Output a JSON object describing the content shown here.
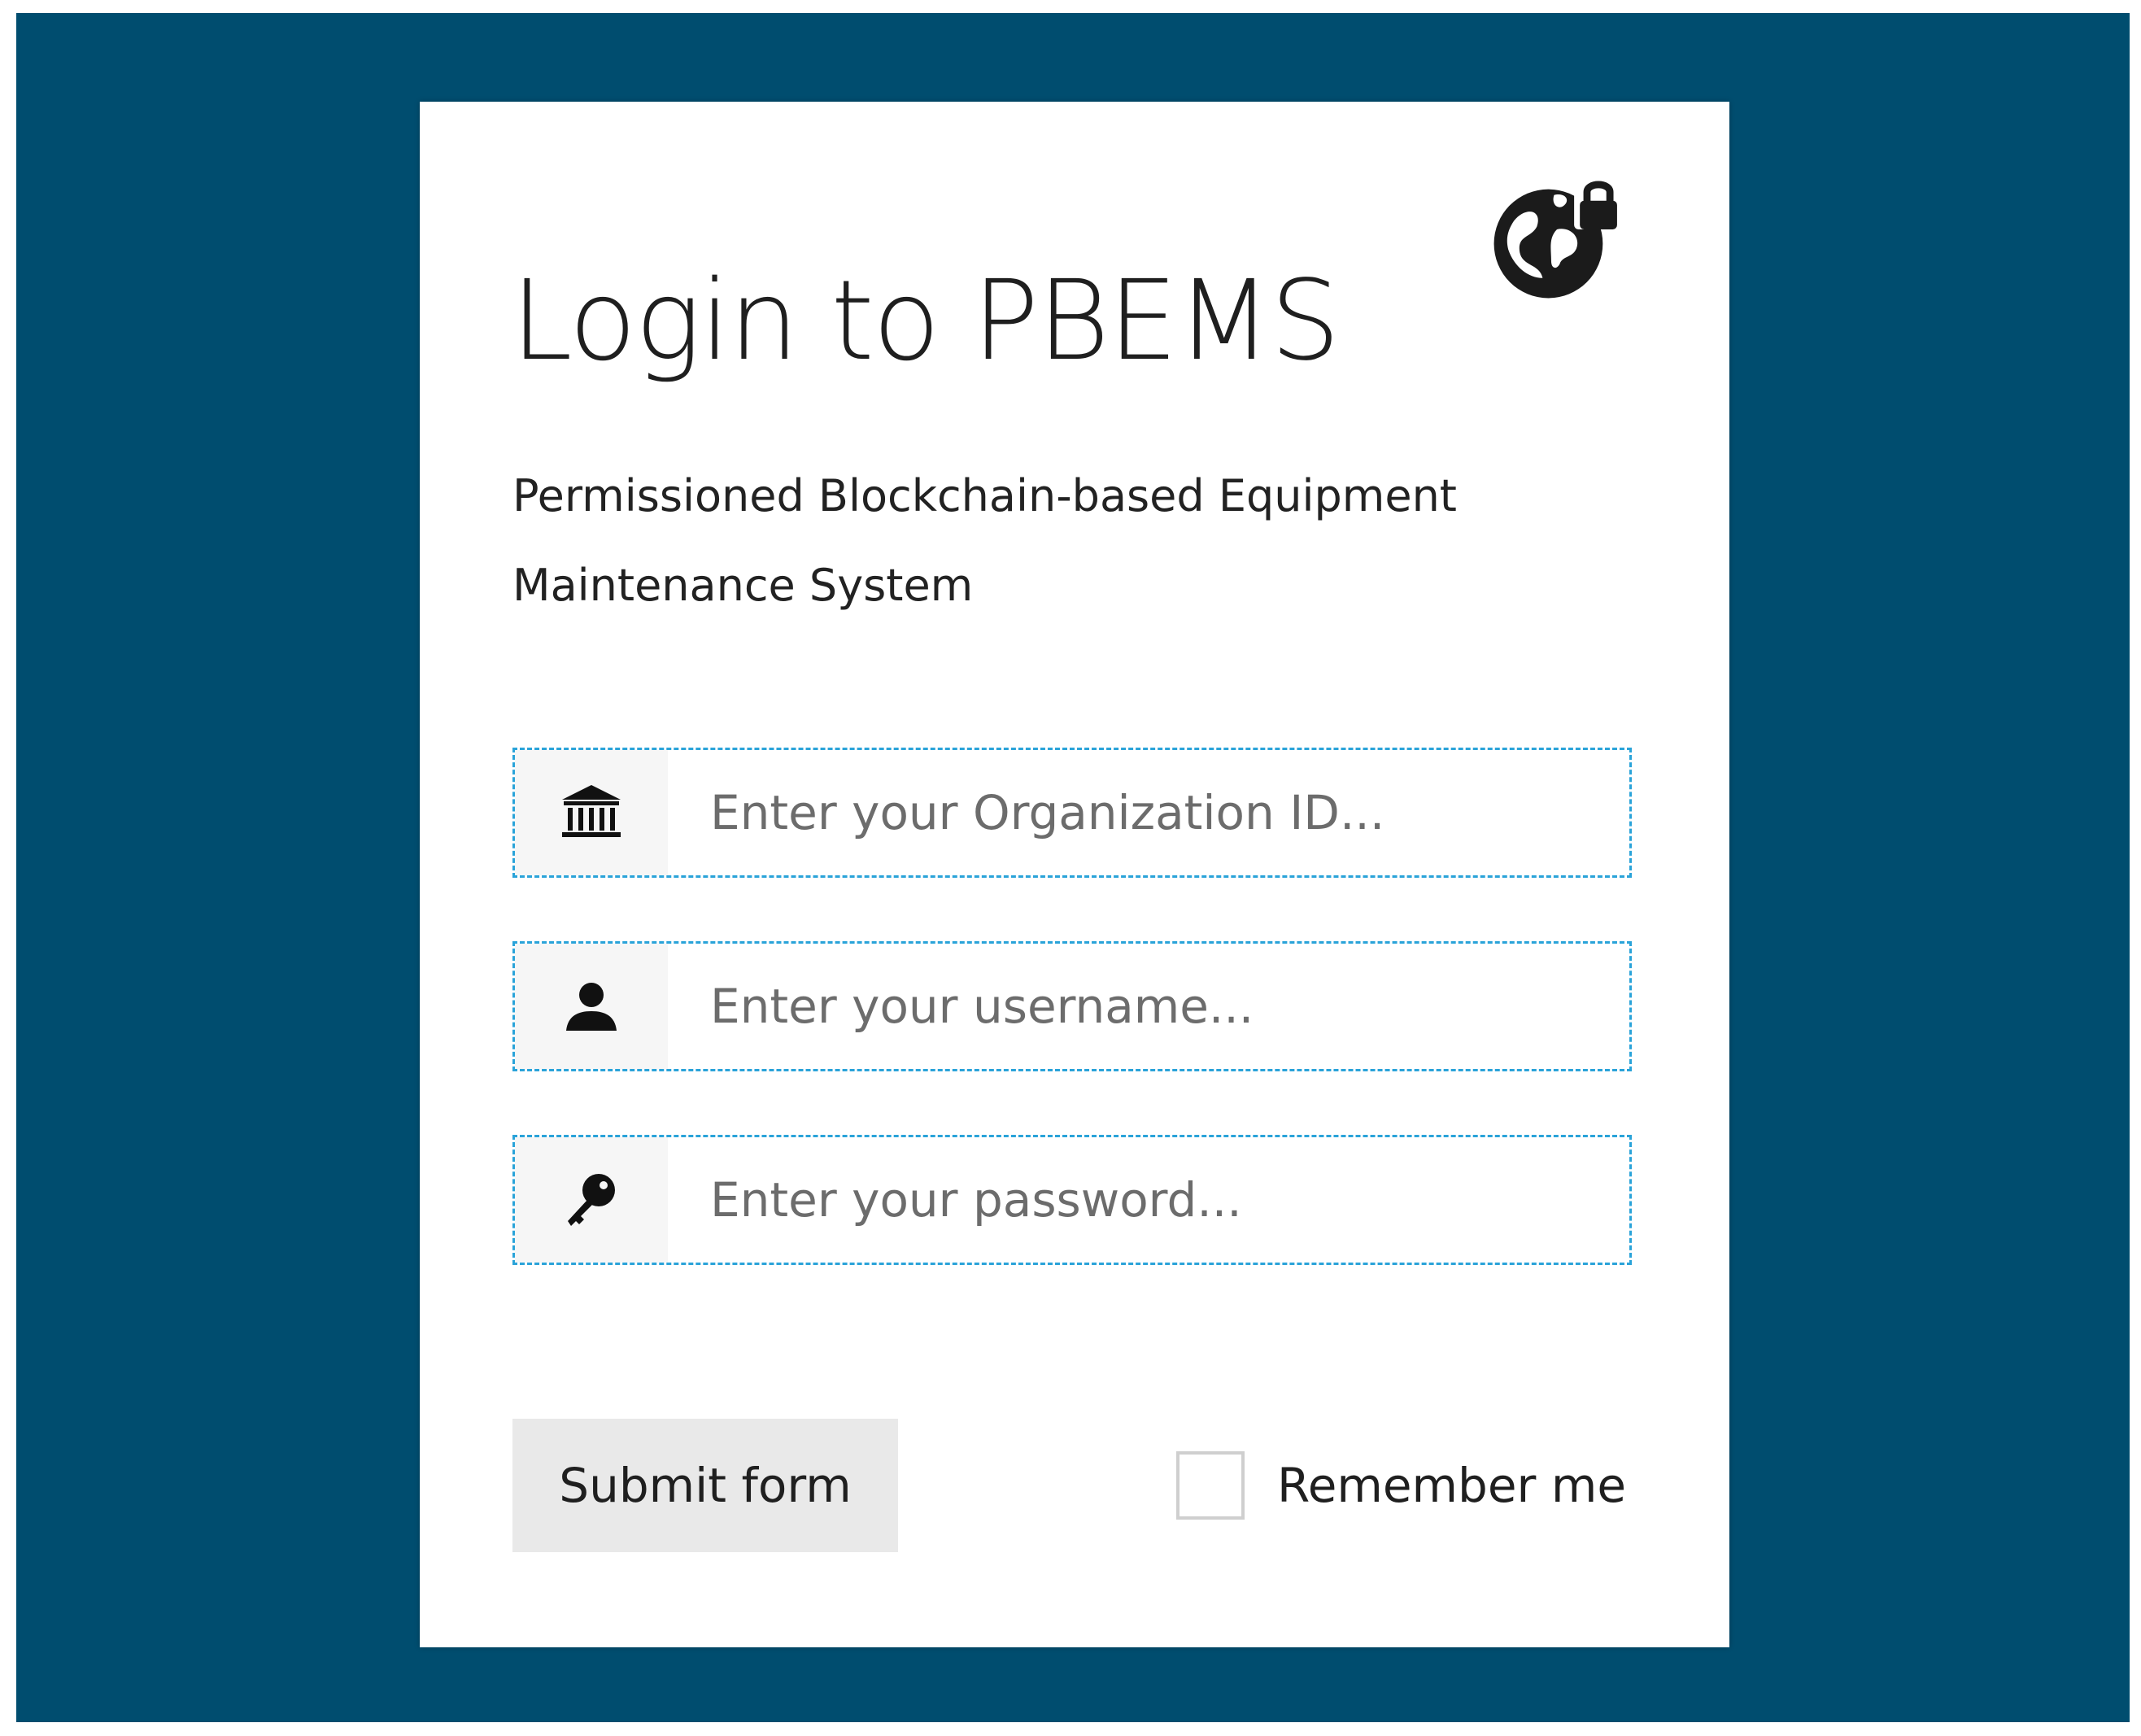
{
  "colors": {
    "background": "#004d6f",
    "card": "#ffffff",
    "field_border": "#2aa3d9",
    "button_bg": "#e9e9e9"
  },
  "header": {
    "title": "Login to PBEMS",
    "subtitle": "Permissioned Blockchain-based Equipment Maintenance System",
    "logo_icon": "globe-lock-icon"
  },
  "form": {
    "organization": {
      "icon": "bank-icon",
      "value": "",
      "placeholder": "Enter your Organization ID..."
    },
    "username": {
      "icon": "user-icon",
      "value": "",
      "placeholder": "Enter your username..."
    },
    "password": {
      "icon": "key-icon",
      "value": "",
      "placeholder": "Enter your password..."
    },
    "submit_label": "Submit form",
    "remember_label": "Remember me",
    "remember_checked": false
  }
}
